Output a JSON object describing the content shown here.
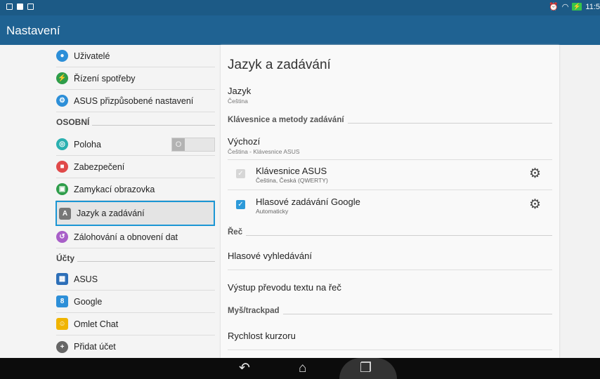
{
  "status_bar": {
    "time": "11:5"
  },
  "app_bar": {
    "title": "Nastavení"
  },
  "left": {
    "items": [
      {
        "label": "Uživatelé",
        "color": "#2d8fd8",
        "glyph": "●"
      },
      {
        "label": "Řízení spotřeby",
        "color": "#2e9d4a",
        "glyph": "⚡"
      },
      {
        "label": "ASUS přizpůsobené nastavení",
        "color": "#2d8fd8",
        "glyph": "⚙"
      }
    ],
    "section_personal": "OSOBNÍ",
    "personal": [
      {
        "label": "Poloha",
        "color": "#2ab0b0",
        "glyph": "◎",
        "toggle": "O"
      },
      {
        "label": "Zabezpečení",
        "color": "#e04a4a",
        "glyph": "🔒"
      },
      {
        "label": "Zamykací obrazovka",
        "color": "#2e9d4a",
        "glyph": "▣"
      },
      {
        "label": "Jazyk a zadávání",
        "color": "#777777",
        "glyph": "A"
      },
      {
        "label": "Zálohování a obnovení dat",
        "color": "#a85fc8",
        "glyph": "↺"
      }
    ],
    "section_accounts": "Účty",
    "accounts": [
      {
        "label": "ASUS",
        "color": "#2d6fb8",
        "glyph": "▦"
      },
      {
        "label": "Google",
        "color": "#2d8fd8",
        "glyph": "8"
      },
      {
        "label": "Omlet Chat",
        "color": "#f0b400",
        "glyph": "☺"
      },
      {
        "label": "Přidat účet",
        "color": "#666666",
        "glyph": "+"
      }
    ]
  },
  "right": {
    "title": "Jazyk a zadávání",
    "language": {
      "title": "Jazyk",
      "subtitle": "Čeština"
    },
    "section_keyboards": "Klávesnice a metody zadávání",
    "default": {
      "title": "Výchozí",
      "subtitle": "Čeština - Klávesnice ASUS"
    },
    "asus_keyboard": {
      "title": "Klávesnice ASUS",
      "subtitle": "Čeština, Česká (QWERTY)"
    },
    "google_voice": {
      "title": "Hlasové zadávání Google",
      "subtitle": "Automaticky"
    },
    "section_speech": "Řeč",
    "voice_search": "Hlasové vyhledávání",
    "tts": "Výstup převodu textu na řeč",
    "section_mouse": "Myš/trackpad",
    "pointer_speed": "Rychlost kurzoru"
  },
  "nav": {
    "back": "↶",
    "home": "⌂",
    "recents": "❐"
  },
  "colors": {
    "status_bar": "#1c5a86",
    "app_bar": "#1f6292",
    "selection": "#1b96d4",
    "checkbox": "#2d9ad9"
  }
}
